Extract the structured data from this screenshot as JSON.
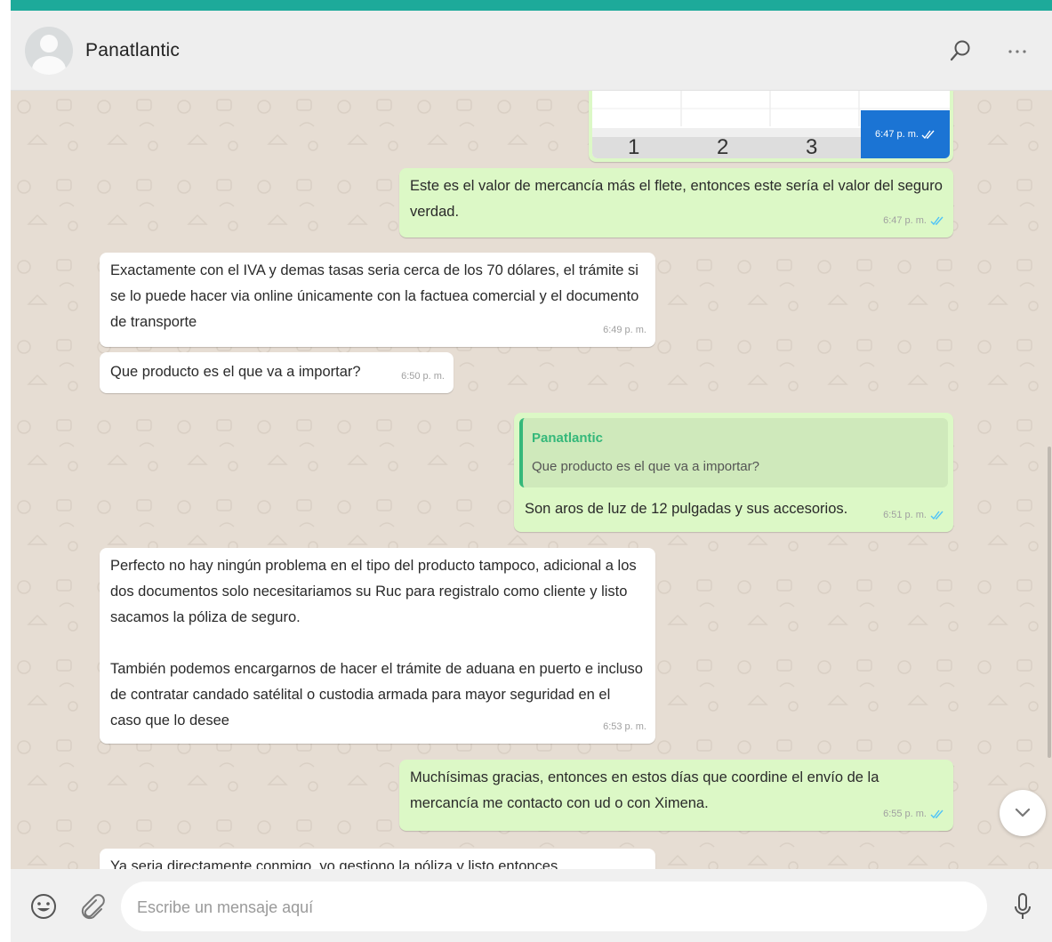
{
  "header": {
    "contact_name": "Panatlantic",
    "avatar_icon": "default-avatar-icon",
    "search_icon": "search-icon",
    "menu_icon": "more-options-icon"
  },
  "chat": {
    "image_message": {
      "visible_keys": [
        "1",
        "2",
        "3"
      ],
      "time": "6:47 p. m."
    },
    "messages": [
      {
        "direction": "outgoing",
        "text": "Este es el valor de mercancía más el flete, entonces este sería el valor del seguro verdad.",
        "time": "6:47 p. m.",
        "status": "read"
      },
      {
        "direction": "incoming",
        "text": "Exactamente con el IVA y demas tasas seria cerca de los 70 dólares, el trámite si se lo puede hacer via online únicamente con la factuea comercial y el documento de transporte",
        "time": "6:49 p. m."
      },
      {
        "direction": "incoming",
        "text": "Que producto es el que va a importar?",
        "time": "6:50 p. m."
      },
      {
        "direction": "outgoing",
        "quoted_author": "Panatlantic",
        "quoted_text": "Que producto es el que va a importar?",
        "text": "Son aros de luz de 12 pulgadas y sus accesorios.",
        "time": "6:51 p. m.",
        "status": "read"
      },
      {
        "direction": "incoming",
        "text": "Perfecto no hay ningún problema en el tipo del producto tampoco, adicional a los dos documentos solo necesitariamos su Ruc para registralo como cliente y listo sacamos la póliza de seguro.\n\nTambién podemos encargarnos de hacer el trámite de aduana en puerto e incluso de contratar candado satélital o custodia armada para mayor seguridad en el caso que lo desee",
        "time": "6:53 p. m."
      },
      {
        "direction": "outgoing",
        "text": "Muchísimas gracias, entonces en estos días que coordine el envío de la mercancía me contacto con ud o con Ximena.",
        "time": "6:55 p. m.",
        "status": "read"
      },
      {
        "direction": "incoming",
        "text": "Ya seria directamente conmigo, yo gestiono la póliza y listo entonces",
        "time": ""
      }
    ],
    "colors": {
      "incoming_bubble": "#ffffff",
      "outgoing_bubble": "#dcf8c6",
      "chat_background": "#e6ddd3",
      "accent": "#1daa9a",
      "read_ticks": "#4fc3f7"
    }
  },
  "composer": {
    "placeholder": "Escribe un mensaje aquí",
    "emoji_icon": "emoji-icon",
    "attach_icon": "paperclip-icon",
    "mic_icon": "microphone-icon",
    "scroll_icon": "chevron-down-icon"
  }
}
